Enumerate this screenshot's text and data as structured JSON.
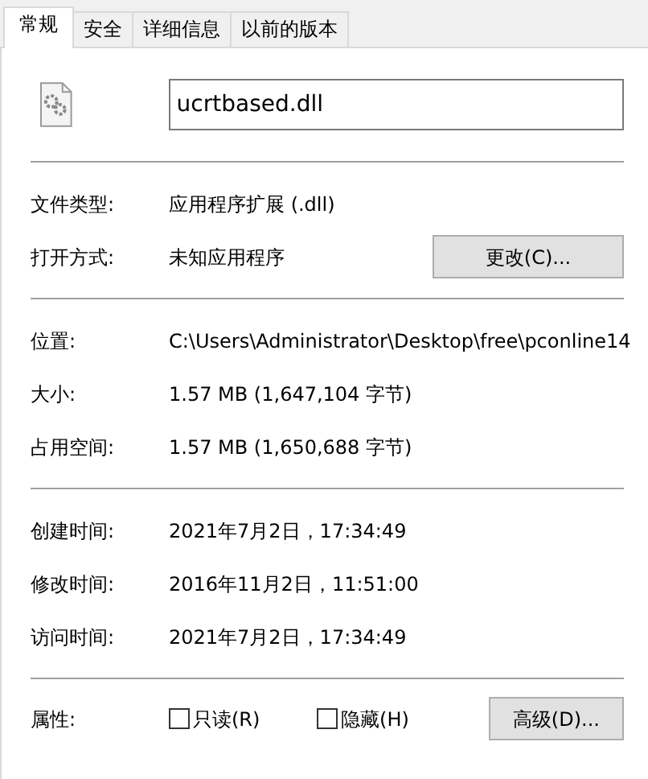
{
  "tabs": [
    {
      "label": "常规",
      "selected": true
    },
    {
      "label": "安全",
      "selected": false
    },
    {
      "label": "详细信息",
      "selected": false
    },
    {
      "label": "以前的版本",
      "selected": false
    }
  ],
  "file_name": {
    "value": "ucrtbased.dll"
  },
  "sections": [
    {
      "rows": [
        {
          "kind": "text",
          "label": "文件类型:",
          "value": "应用程序扩展 (.dll)"
        },
        {
          "kind": "button",
          "label": "打开方式:",
          "value": "未知应用程序",
          "button": "更改(C)..."
        }
      ]
    },
    {
      "rows": [
        {
          "kind": "text",
          "label": "位置:",
          "value": "C:\\Users\\Administrator\\Desktop\\free\\pconline14"
        },
        {
          "kind": "text",
          "label": "大小:",
          "value": "1.57 MB (1,647,104 字节)"
        },
        {
          "kind": "text",
          "label": "占用空间:",
          "value": "1.57 MB (1,650,688 字节)"
        }
      ]
    },
    {
      "rows": [
        {
          "kind": "text",
          "label": "创建时间:",
          "value": "2021年7月2日，17:34:49"
        },
        {
          "kind": "text",
          "label": "修改时间:",
          "value": "2016年11月2日，11:51:00"
        },
        {
          "kind": "text",
          "label": "访问时间:",
          "value": "2021年7月2日，17:34:49"
        }
      ]
    }
  ],
  "attributes": {
    "label": "属性:",
    "checkboxes": [
      {
        "label": "只读(R)",
        "checked": false
      },
      {
        "label": "隐藏(H)",
        "checked": false
      }
    ],
    "button": "高级(D)..."
  }
}
